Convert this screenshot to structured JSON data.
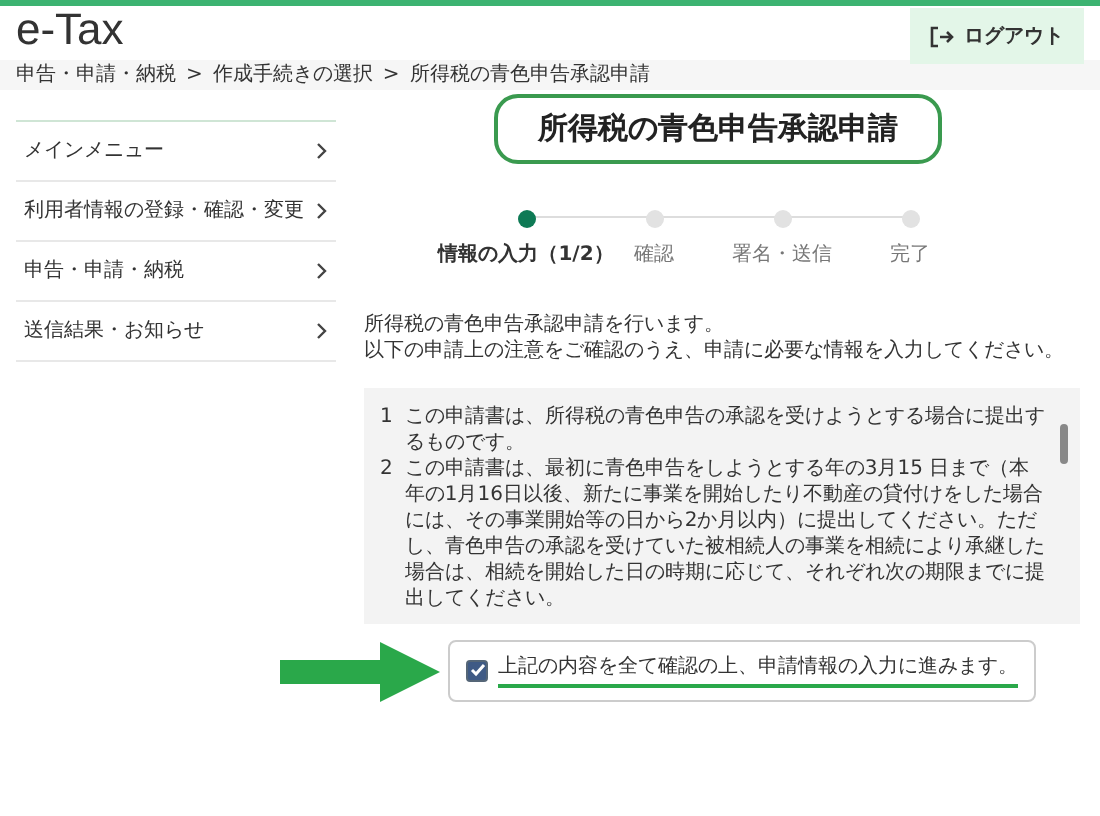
{
  "header": {
    "logo": "e-Tax",
    "logout": "ログアウト"
  },
  "breadcrumbs": [
    "申告・申請・納税",
    "作成手続きの選択",
    "所得税の青色申告承認申請"
  ],
  "breadcrumb_separator": ">",
  "sidebar": {
    "items": [
      {
        "label": "メインメニュー"
      },
      {
        "label": "利用者情報の登録・確認・変更"
      },
      {
        "label": "申告・申請・納税"
      },
      {
        "label": "送信結果・お知らせ"
      }
    ]
  },
  "title": "所得税の青色申告承認申請",
  "steps": [
    {
      "label": "情報の入力（1/2）",
      "active": true
    },
    {
      "label": "確認",
      "active": false
    },
    {
      "label": "署名・送信",
      "active": false
    },
    {
      "label": "完了",
      "active": false
    }
  ],
  "intro": [
    "所得税の青色申告承認申請を行います。",
    "以下の申請上の注意をご確認のうえ、申請に必要な情報を入力してください。"
  ],
  "notices": [
    {
      "number": "1",
      "text": "この申請書は、所得税の青色申告の承認を受けようとする場合に提出するものです。"
    },
    {
      "number": "2",
      "text": "この申請書は、最初に青色申告をしようとする年の3月15 日まで（本年の1月16日以後、新たに事業を開始したり不動産の貸付けをした場合には、その事業開始等の日から2か月以内）に提出してください。ただし、青色申告の承認を受けていた被相続人の事業を相続により承継した場合は、相続を開始した日の時期に応じて、それぞれ次の期限までに提出してください。"
    }
  ],
  "agreement": {
    "label": "上記の内容を全て確認の上、申請情報の入力に進みます。",
    "checked": true
  }
}
